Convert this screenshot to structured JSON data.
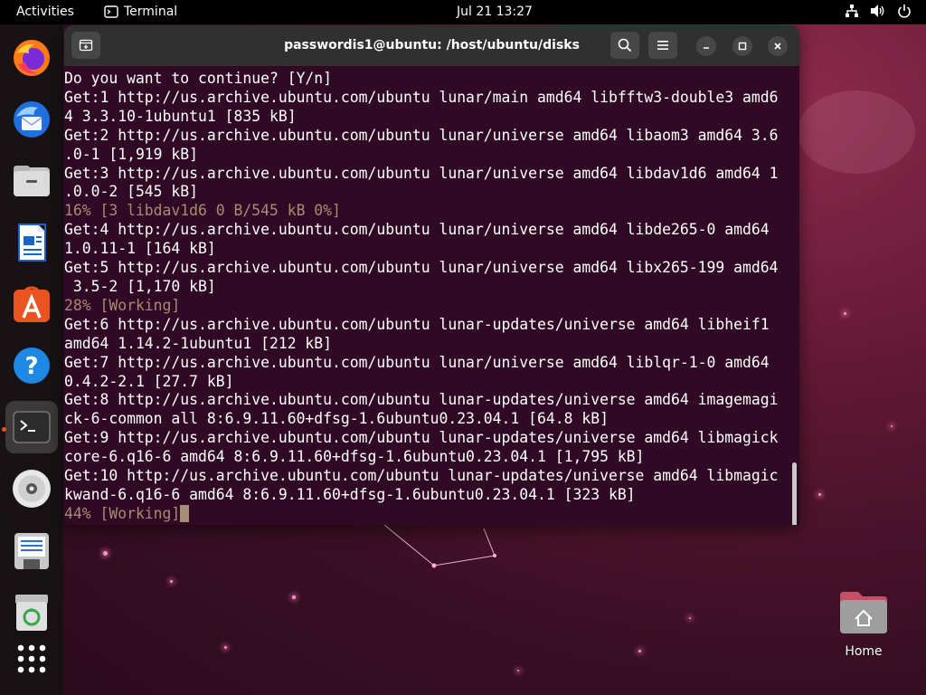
{
  "topbar": {
    "activities": "Activities",
    "app_name": "Terminal",
    "clock": "Jul 21  13:27",
    "tray_icons": [
      "network-icon",
      "volume-icon",
      "power-icon"
    ]
  },
  "dock": {
    "items": [
      {
        "name": "Firefox",
        "icon": "firefox-icon"
      },
      {
        "name": "Thunderbird",
        "icon": "thunderbird-icon"
      },
      {
        "name": "Files",
        "icon": "files-icon"
      },
      {
        "name": "LibreOffice Writer",
        "icon": "writer-icon"
      },
      {
        "name": "Ubuntu Software",
        "icon": "software-icon"
      },
      {
        "name": "Help",
        "icon": "help-icon"
      },
      {
        "name": "Terminal",
        "icon": "terminal-icon",
        "active": true
      },
      {
        "name": "Disc",
        "icon": "disc-icon"
      },
      {
        "name": "Text Editor",
        "icon": "text-editor-icon"
      },
      {
        "name": "Trash",
        "icon": "trash-icon"
      },
      {
        "name": "Show Applications",
        "icon": "app-grid-icon"
      }
    ]
  },
  "terminal": {
    "title": "passwordis1@ubuntu: /host/ubuntu/disks",
    "lines": [
      "Do you want to continue? [Y/n]",
      "Get:1 http://us.archive.ubuntu.com/ubuntu lunar/main amd64 libfftw3-double3 amd6",
      "4 3.3.10-1ubuntu1 [835 kB]",
      "Get:2 http://us.archive.ubuntu.com/ubuntu lunar/universe amd64 libaom3 amd64 3.6",
      ".0-1 [1,919 kB]",
      "Get:3 http://us.archive.ubuntu.com/ubuntu lunar/universe amd64 libdav1d6 amd64 1",
      ".0.0-2 [545 kB]",
      "16% [3 libdav1d6 0 B/545 kB 0%]",
      "Get:4 http://us.archive.ubuntu.com/ubuntu lunar/universe amd64 libde265-0 amd64",
      "1.0.11-1 [164 kB]",
      "Get:5 http://us.archive.ubuntu.com/ubuntu lunar/universe amd64 libx265-199 amd64",
      " 3.5-2 [1,170 kB]",
      "28% [Working]",
      "Get:6 http://us.archive.ubuntu.com/ubuntu lunar-updates/universe amd64 libheif1",
      "amd64 1.14.2-1ubuntu1 [212 kB]",
      "Get:7 http://us.archive.ubuntu.com/ubuntu lunar/universe amd64 liblqr-1-0 amd64",
      "0.4.2-2.1 [27.7 kB]",
      "Get:8 http://us.archive.ubuntu.com/ubuntu lunar-updates/universe amd64 imagemagi",
      "ck-6-common all 8:6.9.11.60+dfsg-1.6ubuntu0.23.04.1 [64.8 kB]",
      "Get:9 http://us.archive.ubuntu.com/ubuntu lunar-updates/universe amd64 libmagick",
      "core-6.q16-6 amd64 8:6.9.11.60+dfsg-1.6ubuntu0.23.04.1 [1,795 kB]",
      "Get:10 http://us.archive.ubuntu.com/ubuntu lunar-updates/universe amd64 libmagic",
      "kwand-6.q16-6 amd64 8:6.9.11.60+dfsg-1.6ubuntu0.23.04.1 [323 kB]",
      "44% [Working]"
    ],
    "progress_line_indexes": [
      7,
      12,
      23
    ],
    "colors": {
      "background": "#300a24",
      "text": "#ffffff",
      "progress_text": "#a58c74"
    }
  },
  "desktop": {
    "home_label": "Home"
  }
}
